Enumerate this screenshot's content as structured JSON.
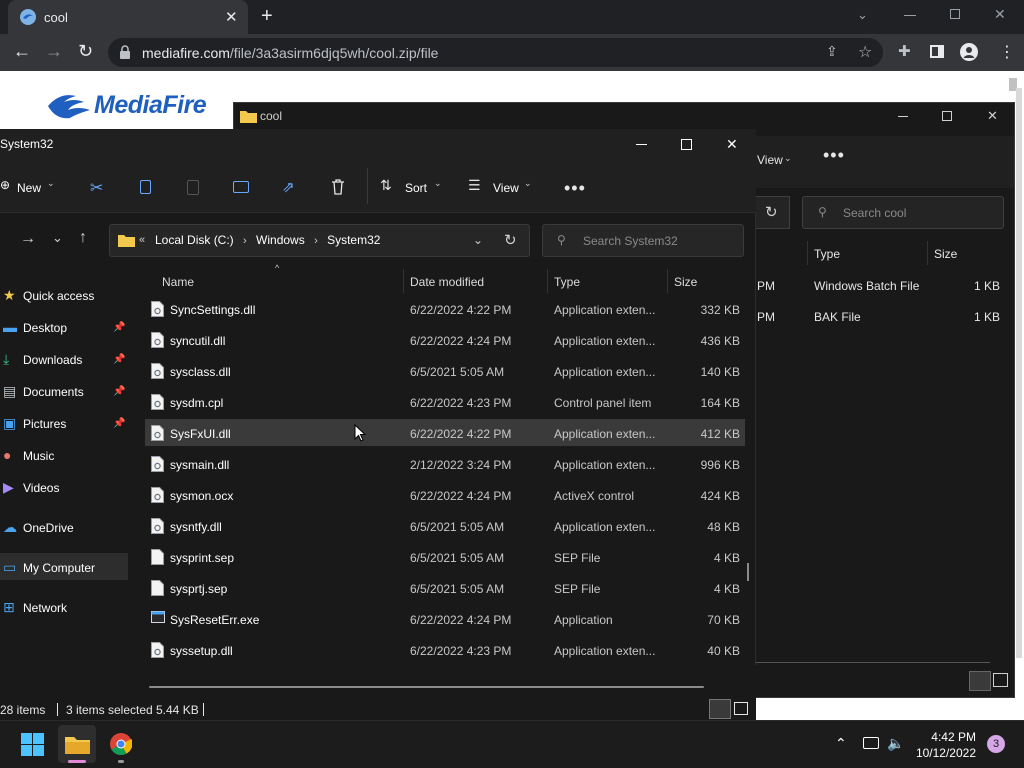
{
  "browser": {
    "tab_title": "cool",
    "url_domain": "mediafire.com",
    "url_path": "/file/3a3asirm6djq5wh/cool.zip/file"
  },
  "page": {
    "logo_text": "MediaFire"
  },
  "cool_window": {
    "title": "cool",
    "view_label": "View",
    "search_placeholder": "Search cool",
    "columns": [
      "Type",
      "Size"
    ],
    "rows": [
      {
        "date_tail": "PM",
        "type": "Windows Batch File",
        "size": "1 KB"
      },
      {
        "date_tail": "PM",
        "type": "BAK File",
        "size": "1 KB"
      }
    ]
  },
  "explorer": {
    "title": "System32",
    "toolbar": {
      "new_label": "New",
      "sort_label": "Sort",
      "view_label": "View"
    },
    "breadcrumb": [
      "Local Disk (C:)",
      "Windows",
      "System32"
    ],
    "search_placeholder": "Search System32",
    "columns": {
      "name": "Name",
      "date": "Date modified",
      "type": "Type",
      "size": "Size"
    },
    "files": [
      {
        "name": "SyncSettings.dll",
        "date": "6/22/2022 4:22 PM",
        "type": "Application exten...",
        "size": "332 KB",
        "icon": "dll-file-icon"
      },
      {
        "name": "syncutil.dll",
        "date": "6/22/2022 4:24 PM",
        "type": "Application exten...",
        "size": "436 KB",
        "icon": "dll-file-icon"
      },
      {
        "name": "sysclass.dll",
        "date": "6/5/2021 5:05 AM",
        "type": "Application exten...",
        "size": "140 KB",
        "icon": "dll-file-icon"
      },
      {
        "name": "sysdm.cpl",
        "date": "6/22/2022 4:23 PM",
        "type": "Control panel item",
        "size": "164 KB",
        "icon": "cpl-file-icon"
      },
      {
        "name": "SysFxUI.dll",
        "date": "6/22/2022 4:22 PM",
        "type": "Application exten...",
        "size": "412 KB",
        "icon": "dll-file-icon"
      },
      {
        "name": "sysmain.dll",
        "date": "2/12/2022 3:24 PM",
        "type": "Application exten...",
        "size": "996 KB",
        "icon": "dll-file-icon"
      },
      {
        "name": "sysmon.ocx",
        "date": "6/22/2022 4:24 PM",
        "type": "ActiveX control",
        "size": "424 KB",
        "icon": "ocx-file-icon"
      },
      {
        "name": "sysntfy.dll",
        "date": "6/5/2021 5:05 AM",
        "type": "Application exten...",
        "size": "48 KB",
        "icon": "dll-file-icon"
      },
      {
        "name": "sysprint.sep",
        "date": "6/5/2021 5:05 AM",
        "type": "SEP File",
        "size": "4 KB",
        "icon": "file-icon"
      },
      {
        "name": "sysprtj.sep",
        "date": "6/5/2021 5:05 AM",
        "type": "SEP File",
        "size": "4 KB",
        "icon": "file-icon"
      },
      {
        "name": "SysResetErr.exe",
        "date": "6/22/2022 4:24 PM",
        "type": "Application",
        "size": "70 KB",
        "icon": "exe-file-icon"
      },
      {
        "name": "syssetup.dll",
        "date": "6/22/2022 4:23 PM",
        "type": "Application exten...",
        "size": "40 KB",
        "icon": "dll-file-icon"
      }
    ],
    "selected_row": "SysFxUI.dll",
    "nav": [
      {
        "label": "Quick access",
        "icon": "star-icon",
        "pinned": false
      },
      {
        "label": "Desktop",
        "icon": "desktop-icon",
        "pinned": true
      },
      {
        "label": "Downloads",
        "icon": "download-icon",
        "pinned": true
      },
      {
        "label": "Documents",
        "icon": "documents-icon",
        "pinned": true
      },
      {
        "label": "Pictures",
        "icon": "pictures-icon",
        "pinned": true
      },
      {
        "label": "Music",
        "icon": "music-icon",
        "pinned": false
      },
      {
        "label": "Videos",
        "icon": "videos-icon",
        "pinned": false
      },
      {
        "label": "OneDrive",
        "icon": "cloud-icon",
        "pinned": false
      },
      {
        "label": "My Computer",
        "icon": "computer-icon",
        "pinned": false
      },
      {
        "label": "Network",
        "icon": "network-icon",
        "pinned": false
      }
    ],
    "status": {
      "item_count": "28 items",
      "selection": "3 items selected",
      "selection_size": "5.44 KB"
    }
  },
  "taskbar": {
    "time": "4:42 PM",
    "date": "10/12/2022",
    "notification_count": "3"
  },
  "colors": {
    "accent_blue": "#1f5fbf",
    "selected_row": "#3a3a3a",
    "folder_yellow": "#f2c94c",
    "window_bg": "#191919"
  }
}
